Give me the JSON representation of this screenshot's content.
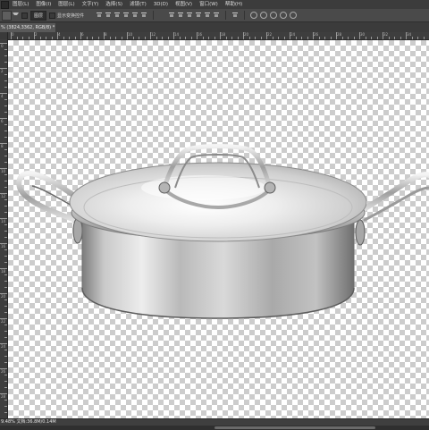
{
  "menubar": {
    "items": [
      "图层(L)",
      "图像(I)",
      "图层(L)",
      "文字(Y)",
      "选择(S)",
      "滤镜(T)",
      "3D(D)",
      "视图(V)",
      "窗口(W)",
      "帮助(H)"
    ]
  },
  "options": {
    "auto_select_value": "图层",
    "show_transform_label": "显示变换控件"
  },
  "document": {
    "tab_title": "% (3824,3362, RGB/8) *",
    "close_glyph": "×"
  },
  "rulers": {
    "h_labels": [
      "0",
      "2",
      "4",
      "6",
      "8",
      "10",
      "12",
      "14",
      "16",
      "18",
      "20",
      "22",
      "24",
      "26",
      "28",
      "30",
      "32",
      "34"
    ],
    "v_labels": [
      "0",
      "2",
      "4",
      "6",
      "8",
      "10",
      "12",
      "14",
      "16",
      "18",
      "20",
      "22",
      "24",
      "26",
      "28"
    ]
  },
  "canvas": {
    "subject": "stainless-steel-casserole-pot",
    "background": "transparency-checkerboard"
  },
  "status": {
    "zoom_doc": "9.48% 文档:36.8M/0.14M"
  },
  "colors": {
    "menubar_bg": "#3c3c3c",
    "optionsbar_bg": "#4a4a4a",
    "checker_light": "#ffffff",
    "checker_dark": "#cccccc"
  }
}
